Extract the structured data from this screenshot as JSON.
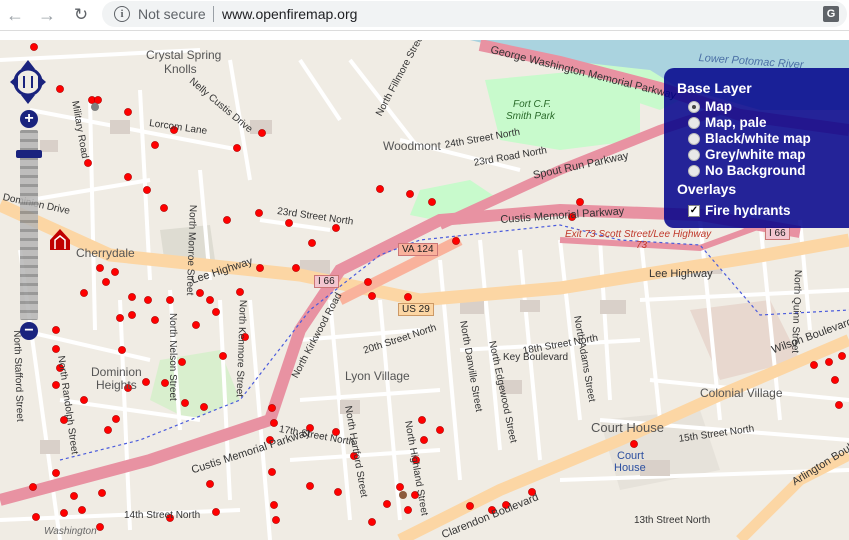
{
  "browser": {
    "security_label": "Not secure",
    "url": "www.openfiremap.org",
    "icons": [
      "back-arrow-icon",
      "forward-arrow-icon",
      "reload-icon",
      "info-icon",
      "translate-icon"
    ]
  },
  "map": {
    "place_labels": [
      {
        "text": "Crystal Spring"
      },
      {
        "text": "Knolls"
      },
      {
        "text": "Woodmont"
      },
      {
        "text": "Cherrydale"
      },
      {
        "text": "Dominion"
      },
      {
        "text": "Heights"
      },
      {
        "text": "Lyon Village"
      },
      {
        "text": "Colonial Village"
      },
      {
        "text": "Court House"
      },
      {
        "text": "Washington"
      },
      {
        "text": "Fort C.F."
      },
      {
        "text": "Smith Park"
      },
      {
        "text": "Lower Potomac River"
      },
      {
        "text": "Court"
      },
      {
        "text": "House"
      }
    ],
    "road_labels": [
      {
        "text": "George Washington Memorial Parkway"
      },
      {
        "text": "Spout Run Parkway"
      },
      {
        "text": "Custis Memorial Parkway"
      },
      {
        "text": "Exit 73 Scott Street/Lee Highway"
      },
      {
        "text": "Lee Highway"
      },
      {
        "text": "Lorcom Lane"
      },
      {
        "text": "Nelly Custis Drive"
      },
      {
        "text": "North Kirkwood Road"
      },
      {
        "text": "Wilson Boulevard"
      },
      {
        "text": "Clarendon Boulevard"
      },
      {
        "text": "Arlington Boulevard"
      },
      {
        "text": "Key Boulevard"
      },
      {
        "text": "24th Street North"
      },
      {
        "text": "23rd Road North"
      },
      {
        "text": "23rd Street North"
      },
      {
        "text": "20th Street North"
      },
      {
        "text": "18th Street North"
      },
      {
        "text": "17th Street North"
      },
      {
        "text": "14th Street North"
      },
      {
        "text": "15th Street North"
      },
      {
        "text": "13th Street North"
      },
      {
        "text": "North Fillmore Street"
      },
      {
        "text": "Military Road"
      },
      {
        "text": "North Monroe Street"
      },
      {
        "text": "North Nelson Street"
      },
      {
        "text": "North Adams Street"
      },
      {
        "text": "North Quinn Street"
      },
      {
        "text": "Custis Memorial Parkway"
      },
      {
        "text": "North Highland Street"
      },
      {
        "text": "North Danville Street"
      },
      {
        "text": "North Edgewood Street"
      },
      {
        "text": "North Hartford Street"
      },
      {
        "text": "North Stafford Street"
      },
      {
        "text": "North Randolph Street"
      },
      {
        "text": "North Kenmore Street"
      },
      {
        "text": "Dominion Drive"
      }
    ],
    "shields": [
      {
        "text": "VA 124"
      },
      {
        "text": "I 66"
      },
      {
        "text": "US 29"
      },
      {
        "text": "I 66"
      },
      {
        "text": "73"
      }
    ]
  },
  "zoom_control": {
    "zoom_in": "+",
    "zoom_out": "−"
  },
  "layer_switcher": {
    "base_layer_title": "Base Layer",
    "base_layers": [
      {
        "label": "Map",
        "selected": true
      },
      {
        "label": "Map, pale",
        "selected": false
      },
      {
        "label": "Black/white map",
        "selected": false
      },
      {
        "label": "Grey/white map",
        "selected": false
      },
      {
        "label": "No Background",
        "selected": false
      }
    ],
    "overlays_title": "Overlays",
    "overlays": [
      {
        "label": "Fire hydrants",
        "checked": true
      }
    ]
  },
  "colors": {
    "motorway": "#e892a2",
    "trunk": "#f9b29c",
    "primary": "#fcd6a4",
    "water": "#aad3df",
    "park": "#c8facc",
    "hydrant": "#ff0000",
    "layer_panel": "#00008b"
  }
}
